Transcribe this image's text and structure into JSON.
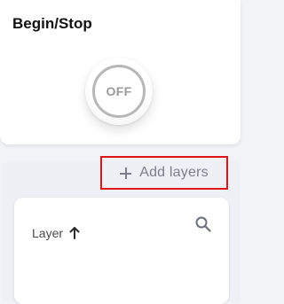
{
  "power": {
    "title": "Begin/Stop",
    "state_label": "OFF"
  },
  "layers": {
    "add_label": "Add layers",
    "column_label": "Layer"
  },
  "colors": {
    "highlight_border": "#e0151b",
    "muted_text": "#7b7f8a"
  },
  "icons": {
    "add": "plus-icon",
    "sort": "arrow-up-icon",
    "search": "search-icon"
  }
}
